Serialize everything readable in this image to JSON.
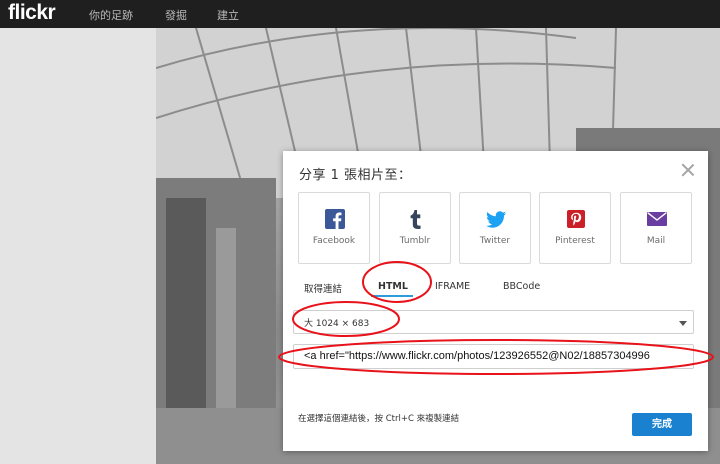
{
  "brand": {
    "logo": "flickr"
  },
  "nav": {
    "items": [
      "你的足跡",
      "發掘",
      "建立"
    ]
  },
  "dialog": {
    "title": "分享 1 張相片至：",
    "share_targets": [
      {
        "label": "Facebook",
        "icon": "facebook-icon",
        "color": "#3b5998"
      },
      {
        "label": "Tumblr",
        "icon": "tumblr-icon",
        "color": "#35465c"
      },
      {
        "label": "Twitter",
        "icon": "twitter-icon",
        "color": "#1da1f2"
      },
      {
        "label": "Pinterest",
        "icon": "pinterest-icon",
        "color": "#cb2027"
      },
      {
        "label": "Mail",
        "icon": "mail-icon",
        "color": "#6a3ea1"
      }
    ],
    "tabs": [
      {
        "label": "取得連結"
      },
      {
        "label": "HTML",
        "active": true
      },
      {
        "label": "IFRAME"
      },
      {
        "label": "BBCode"
      }
    ],
    "size_select": {
      "value": "大 1024 × 683"
    },
    "embed_code": {
      "value": "<a href=\"https://www.flickr.com/photos/123926552@N02/18857304996"
    },
    "hint": "在選擇這個連結後，按 Ctrl+C 來複製連結",
    "done_label": "完成"
  },
  "colors": {
    "accent": "#2f9bdb",
    "button": "#1a80d0",
    "annotation": "#e8121a"
  }
}
